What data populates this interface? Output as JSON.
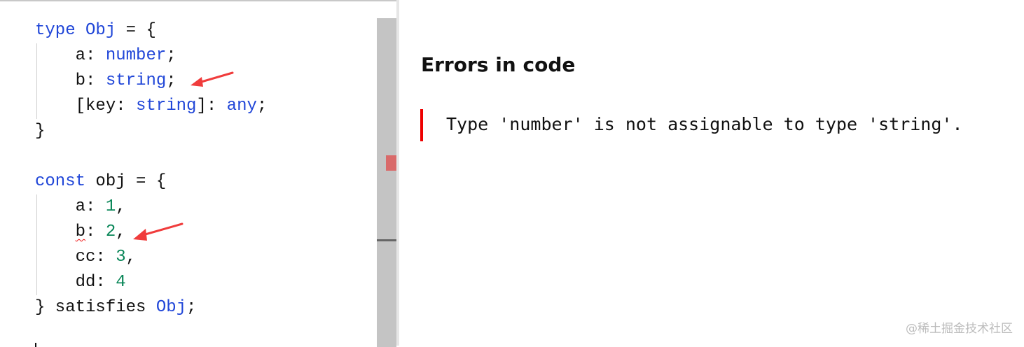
{
  "editor": {
    "lines": [
      [
        {
          "t": "type",
          "c": "kw"
        },
        {
          "t": " "
        },
        {
          "t": "Obj",
          "c": "t"
        },
        {
          "t": " = {"
        }
      ],
      [
        {
          "t": "    a: "
        },
        {
          "t": "number",
          "c": "t"
        },
        {
          "t": ";"
        }
      ],
      [
        {
          "t": "    b: "
        },
        {
          "t": "string",
          "c": "t"
        },
        {
          "t": ";"
        }
      ],
      [
        {
          "t": "    [key: "
        },
        {
          "t": "string",
          "c": "t"
        },
        {
          "t": "]: "
        },
        {
          "t": "any",
          "c": "t"
        },
        {
          "t": ";"
        }
      ],
      [
        {
          "t": "}"
        }
      ],
      [
        {
          "t": ""
        }
      ],
      [
        {
          "t": "const",
          "c": "kw"
        },
        {
          "t": " obj = {"
        }
      ],
      [
        {
          "t": "    a: "
        },
        {
          "t": "1",
          "c": "num"
        },
        {
          "t": ","
        }
      ],
      [
        {
          "t": "    "
        },
        {
          "t": "b",
          "c": "squiggle"
        },
        {
          "t": ": "
        },
        {
          "t": "2",
          "c": "num"
        },
        {
          "t": ","
        }
      ],
      [
        {
          "t": "    cc: "
        },
        {
          "t": "3",
          "c": "num"
        },
        {
          "t": ","
        }
      ],
      [
        {
          "t": "    dd: "
        },
        {
          "t": "4",
          "c": "num"
        }
      ],
      [
        {
          "t": "} satisfies "
        },
        {
          "t": "Obj",
          "c": "t"
        },
        {
          "t": ";"
        }
      ]
    ]
  },
  "panel": {
    "title": "Errors in code",
    "errors": [
      "Type 'number' is not assignable to type 'string'."
    ]
  },
  "watermark": "@稀土掘金技术社区",
  "colors": {
    "keyword": "#2046d8",
    "number": "#098658",
    "error": "#e00000",
    "annotation_arrow": "#f03c3c"
  }
}
